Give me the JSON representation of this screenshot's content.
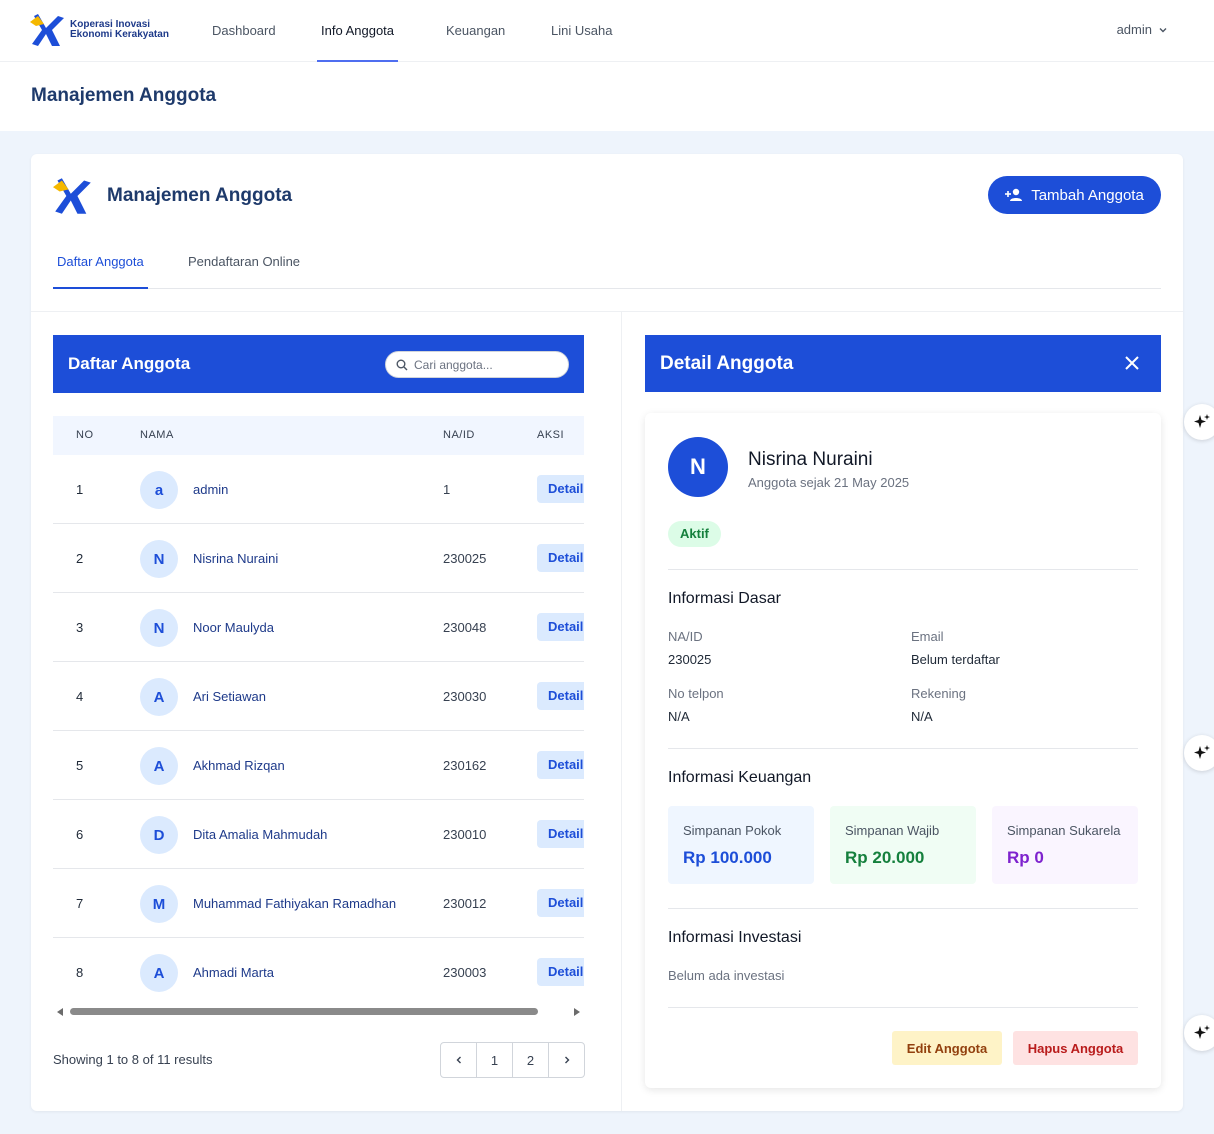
{
  "brand": {
    "line1": "Koperasi Inovasi",
    "line2": "Ekonomi Kerakyatan",
    "logo_icon": "x-star-logo-icon",
    "colors": {
      "blue": "#1d4ed8",
      "yellow": "#f5b800"
    }
  },
  "nav": [
    {
      "label": "Dashboard",
      "active": false
    },
    {
      "label": "Info Anggota",
      "active": true
    },
    {
      "label": "Keuangan",
      "active": false
    },
    {
      "label": "Lini Usaha",
      "active": false
    }
  ],
  "user_menu": {
    "label": "admin",
    "icon": "chevron-down-icon"
  },
  "page_title": "Manajemen Anggota",
  "card": {
    "title": "Manajemen Anggota",
    "add_button": "Tambah Anggota",
    "add_icon": "add-user-icon",
    "tabs": [
      {
        "label": "Daftar Anggota",
        "active": true
      },
      {
        "label": "Pendaftaran Online",
        "active": false
      }
    ]
  },
  "list": {
    "title": "Daftar Anggota",
    "search_placeholder": "Cari anggota...",
    "columns": [
      "NO",
      "NAMA",
      "NA/ID",
      "AKSI"
    ],
    "action_label": "Detail",
    "rows": [
      {
        "no": "1",
        "initial": "a",
        "name": "admin",
        "naid": "1"
      },
      {
        "no": "2",
        "initial": "N",
        "name": "Nisrina Nuraini",
        "naid": "230025"
      },
      {
        "no": "3",
        "initial": "N",
        "name": "Noor Maulyda",
        "naid": "230048"
      },
      {
        "no": "4",
        "initial": "A",
        "name": "Ari Setiawan",
        "naid": "230030"
      },
      {
        "no": "5",
        "initial": "A",
        "name": "Akhmad Rizqan",
        "naid": "230162"
      },
      {
        "no": "6",
        "initial": "D",
        "name": "Dita Amalia Mahmudah",
        "naid": "230010"
      },
      {
        "no": "7",
        "initial": "M",
        "name": "Muhammad Fathiyakan Ramadhan",
        "naid": "230012"
      },
      {
        "no": "8",
        "initial": "A",
        "name": "Ahmadi Marta",
        "naid": "230003"
      }
    ],
    "showing": "Showing 1 to 8 of 11 results",
    "pages": [
      "1",
      "2"
    ]
  },
  "detail": {
    "title": "Detail Anggota",
    "initial": "N",
    "name": "Nisrina Nuraini",
    "since": "Anggota sejak 21 May 2025",
    "status": "Aktif",
    "basic_title": "Informasi Dasar",
    "fields": {
      "naid_label": "NA/ID",
      "naid_value": "230025",
      "email_label": "Email",
      "email_value": "Belum terdaftar",
      "phone_label": "No telpon",
      "phone_value": "N/A",
      "account_label": "Rekening",
      "account_value": "N/A"
    },
    "finance_title": "Informasi Keuangan",
    "finance": [
      {
        "label": "Simpanan Pokok",
        "value": "Rp 100.000",
        "color": "#1d4ed8",
        "bg": "#eff6ff"
      },
      {
        "label": "Simpanan Wajib",
        "value": "Rp 20.000",
        "color": "#15803d",
        "bg": "#f0fdf4"
      },
      {
        "label": "Simpanan Sukarela",
        "value": "Rp 0",
        "color": "#7e22ce",
        "bg": "#faf5ff"
      }
    ],
    "invest_title": "Informasi Investasi",
    "invest_empty": "Belum ada investasi",
    "edit_button": "Edit Anggota",
    "delete_button": "Hapus Anggota"
  }
}
